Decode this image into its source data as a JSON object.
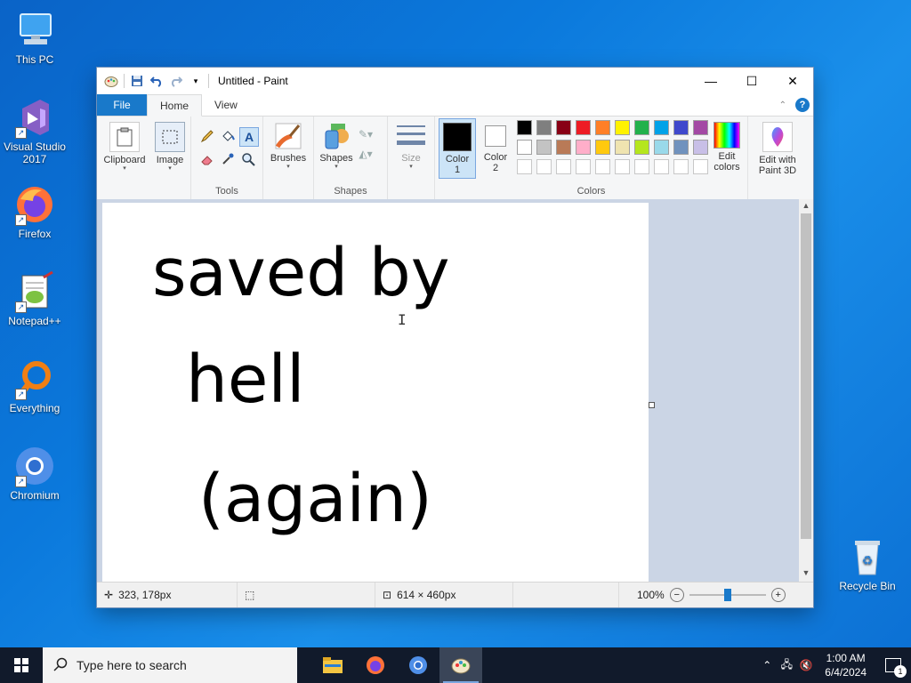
{
  "desktop": {
    "icons": [
      {
        "label": "This PC"
      },
      {
        "label": "Visual Studio 2017"
      },
      {
        "label": "Firefox"
      },
      {
        "label": "Notepad++"
      },
      {
        "label": "Everything"
      },
      {
        "label": "Chromium"
      },
      {
        "label": "Recycle Bin"
      }
    ]
  },
  "window": {
    "title": "Untitled - Paint",
    "controls": {
      "minimize": "—",
      "maximize": "☐",
      "close": "✕"
    }
  },
  "menu": {
    "file": "File",
    "tabs": [
      "Home",
      "View"
    ],
    "help": "?"
  },
  "ribbon": {
    "clipboard": "Clipboard",
    "image": "Image",
    "tools_label": "Tools",
    "brushes": "Brushes",
    "shapes": "Shapes",
    "shapes_label": "Shapes",
    "size": "Size",
    "color1": "Color 1",
    "color2": "Color 2",
    "colors_label": "Colors",
    "edit_colors": "Edit colors",
    "edit_paint3d": "Edit with Paint 3D",
    "palette_row1": [
      "#000000",
      "#7f7f7f",
      "#880015",
      "#ed1c24",
      "#ff7f27",
      "#fff200",
      "#22b14c",
      "#00a2e8",
      "#3f48cc",
      "#a349a4"
    ],
    "palette_row2": [
      "#ffffff",
      "#c3c3c3",
      "#b97a57",
      "#ffaec9",
      "#ffc90e",
      "#efe4b0",
      "#b5e61d",
      "#99d9ea",
      "#7092be",
      "#c8bfe7"
    ],
    "color1_value": "#000000",
    "color2_value": "#ffffff"
  },
  "canvas": {
    "lines": [
      "saved by",
      "hell",
      "(again)"
    ]
  },
  "status": {
    "position": "323, 178px",
    "canvas_size": "614 × 460px",
    "zoom": "100%",
    "zoom_level": 1.0
  },
  "taskbar": {
    "search_placeholder": "Type here to search",
    "time": "1:00 AM",
    "date": "6/4/2024",
    "notifications": "1"
  }
}
